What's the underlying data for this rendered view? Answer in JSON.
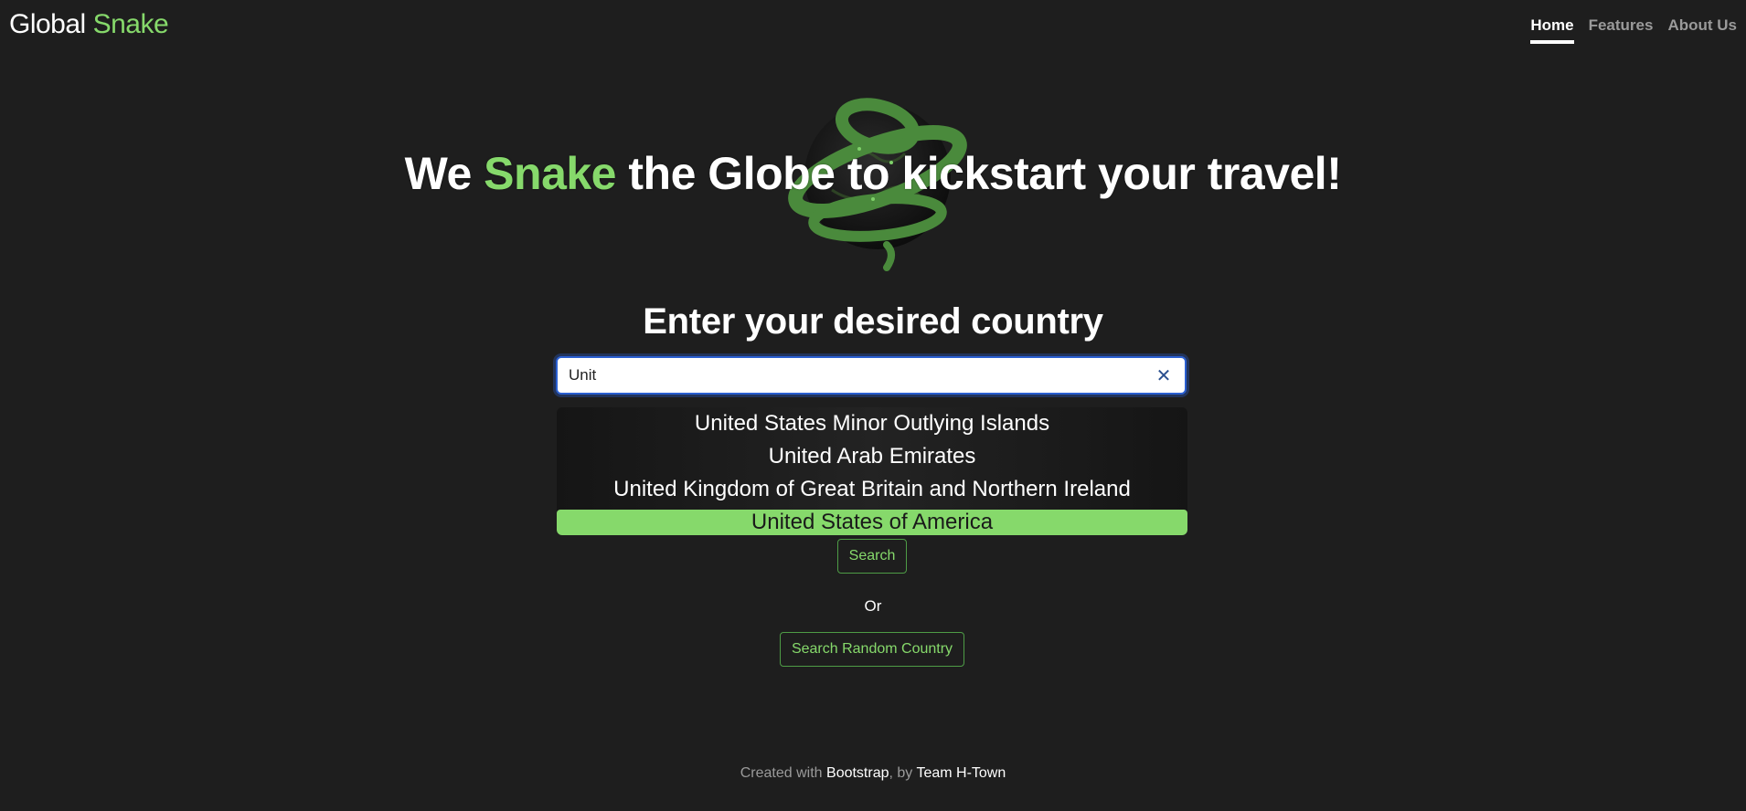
{
  "brand": {
    "part1": "Global",
    "part2": "Snake"
  },
  "nav": {
    "home": "Home",
    "features": "Features",
    "about": "About Us"
  },
  "hero": {
    "pre": "We",
    "accent": "Snake",
    "post": "the Globe to kickstart your travel!"
  },
  "search": {
    "heading": "Enter your desired country",
    "value": "Unit",
    "clear_icon": "close-icon",
    "suggestions": [
      "United States Minor Outlying Islands",
      "United Arab Emirates",
      "United Kingdom of Great Britain and Northern Ireland",
      "United States of America"
    ],
    "button_label": "Search"
  },
  "or_label": "Or",
  "random_label": "Search Random Country",
  "footer": {
    "pre": "Created with",
    "link1": "Bootstrap",
    "mid": ", by",
    "link2": "Team H-Town"
  },
  "colors": {
    "accent": "#86d96b",
    "background": "#1e1e1e",
    "focus": "#2a5fd1"
  }
}
